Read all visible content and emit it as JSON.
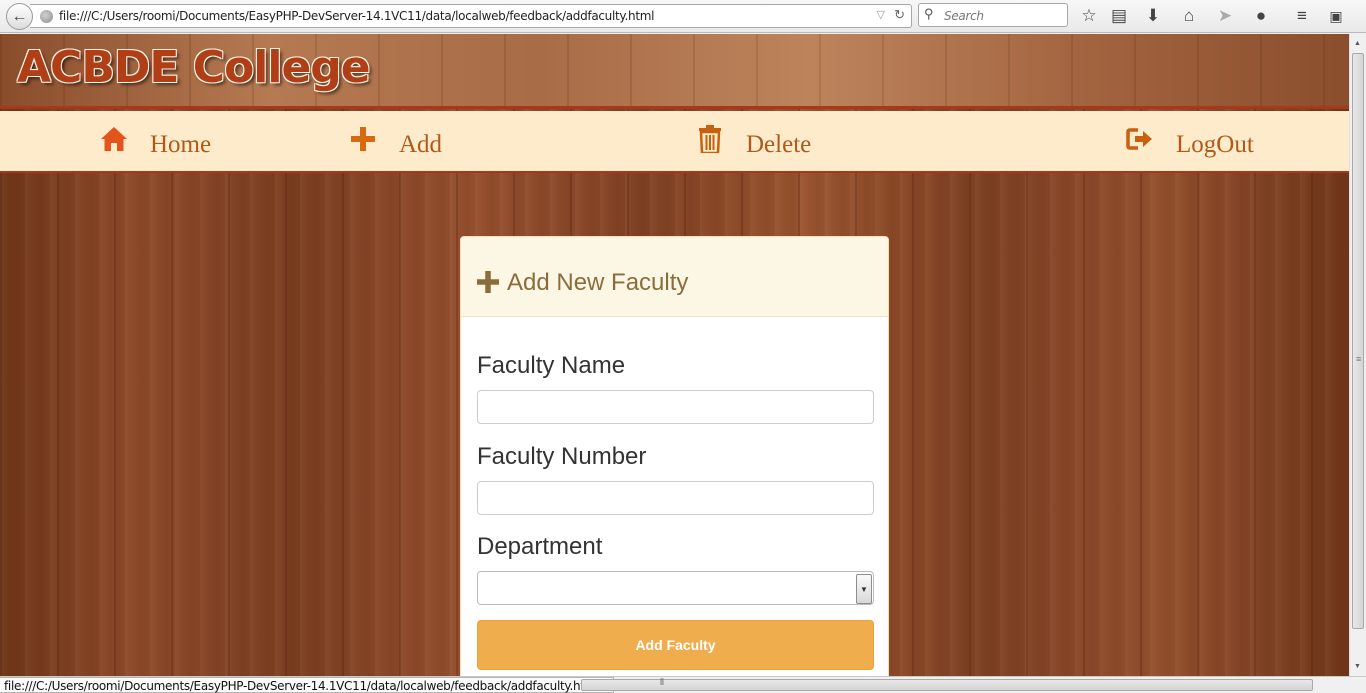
{
  "browser": {
    "url": "file:///C:/Users/roomi/Documents/EasyPHP-DevServer-14.1VC11/data/localweb/feedback/addfaculty.html",
    "search_placeholder": "Search",
    "status_url": "file:///C:/Users/roomi/Documents/EasyPHP-DevServer-14.1VC11/data/localweb/feedback/addfaculty.html#",
    "icons": [
      "back-arrow-icon",
      "globe-icon",
      "dropdown-icon",
      "reload-icon",
      "search-icon",
      "star-icon",
      "reading-list-icon",
      "download-icon",
      "home-icon",
      "send-icon",
      "chat-icon",
      "menu-icon",
      "addon-icon"
    ]
  },
  "site": {
    "title": "ACBDE College"
  },
  "nav": {
    "items": [
      {
        "label": "Home",
        "icon": "home-icon"
      },
      {
        "label": "Add",
        "icon": "plus-icon"
      },
      {
        "label": "Delete",
        "icon": "trash-icon"
      },
      {
        "label": "LogOut",
        "icon": "logout-icon"
      }
    ]
  },
  "form": {
    "heading": "Add New Faculty",
    "faculty_name_label": "Faculty Name",
    "faculty_name_value": "",
    "faculty_number_label": "Faculty Number",
    "faculty_number_value": "",
    "department_label": "Department",
    "department_value": "",
    "submit_label": "Add Faculty"
  },
  "colors": {
    "nav_background": "#fdebcb",
    "nav_text": "#b05a1a",
    "accent_button": "#f0ad4e",
    "title_text": "#b03e17",
    "panel_heading": "#8a6d3b"
  }
}
